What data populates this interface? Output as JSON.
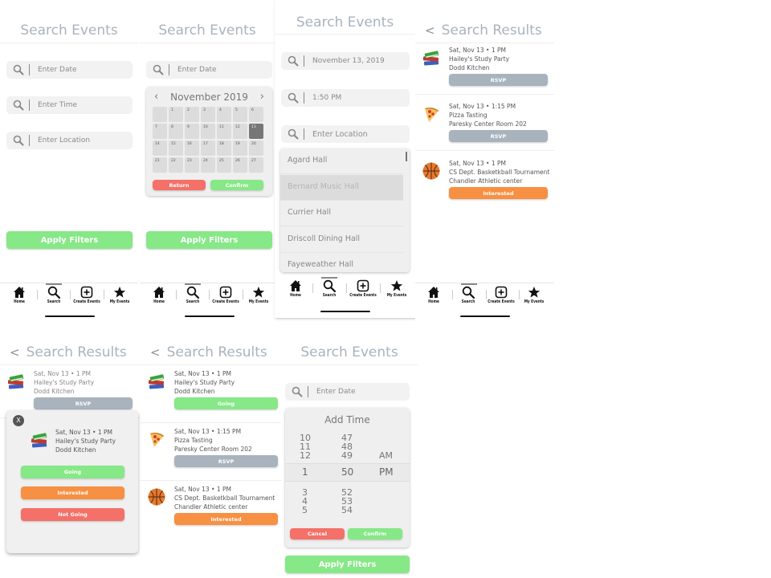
{
  "search_screen": {
    "title": "Search Events",
    "date_placeholder": "Enter Date",
    "time_placeholder": "Enter Time",
    "location_placeholder": "Enter Location",
    "apply_label": "Apply Filters"
  },
  "filled_screen": {
    "date_value": "November 13, 2019",
    "time_value": "1:50 PM"
  },
  "calendar": {
    "month_label": "November 2019",
    "prev_icon": "chevron-left-icon",
    "next_icon": "chevron-right-icon",
    "days": [
      "",
      "1",
      "2",
      "3",
      "4",
      "5",
      "6",
      "7",
      "8",
      "9",
      "10",
      "11",
      "12",
      "13",
      "14",
      "15",
      "16",
      "17",
      "18",
      "19",
      "20",
      "21",
      "22",
      "23",
      "24",
      "25",
      "26",
      "27"
    ],
    "selected_day": "13",
    "return_label": "Return",
    "confirm_label": "Confirm"
  },
  "locations": [
    "Agard Hall",
    "Bernard Music Hall",
    "Currier Hall",
    "Driscoll Dining Hall",
    "Fayeweather Hall"
  ],
  "highlighted_location": "Bernard Music Hall",
  "nav": {
    "items": [
      {
        "label": "Home",
        "icon": "home-icon"
      },
      {
        "label": "Search",
        "icon": "search-icon"
      },
      {
        "label": "Create Events",
        "icon": "plus-square-icon"
      },
      {
        "label": "My Events",
        "icon": "star-icon"
      }
    ],
    "active": "Search"
  },
  "results": {
    "title": "Search Results",
    "back_icon": "chevron-left-icon",
    "events": [
      {
        "when": "Sat, Nov 13 • 1 PM",
        "name": "Hailey's Study Party",
        "place": "Dodd Kitchen",
        "icon": "books-icon"
      },
      {
        "when": "Sat, Nov 13 • 1:15 PM",
        "name": "Pizza Tasting",
        "place": "Paresky Center Room 202",
        "icon": "pizza-icon"
      },
      {
        "when": "Sat, Nov 13 • 1 PM",
        "name": "CS Dept. Basketkball Tournament",
        "place": "Chandler Athletic center",
        "icon": "basketball-icon"
      }
    ],
    "rsvp_label": "RSVP",
    "going_label": "Going",
    "interested_label": "Interested",
    "not_going_label": "Not Going"
  },
  "modal": {
    "close_label": "X"
  },
  "time_picker": {
    "title": "Add Time",
    "hours_above": [
      "10",
      "11",
      "12"
    ],
    "hour_selected": "1",
    "hours_below": [
      "3",
      "4",
      "5"
    ],
    "minutes_above": [
      "47",
      "48",
      "49"
    ],
    "minute_selected": "50",
    "minutes_below": [
      "52",
      "53",
      "54"
    ],
    "period_above": "AM",
    "period_selected": "PM",
    "cancel_label": "Cancel",
    "confirm_label": "Confirm"
  },
  "colors": {
    "green": "#86e886",
    "red": "#f47068",
    "orange": "#f79042",
    "gray": "#a9b3bd",
    "title": "#a9b3bd"
  }
}
